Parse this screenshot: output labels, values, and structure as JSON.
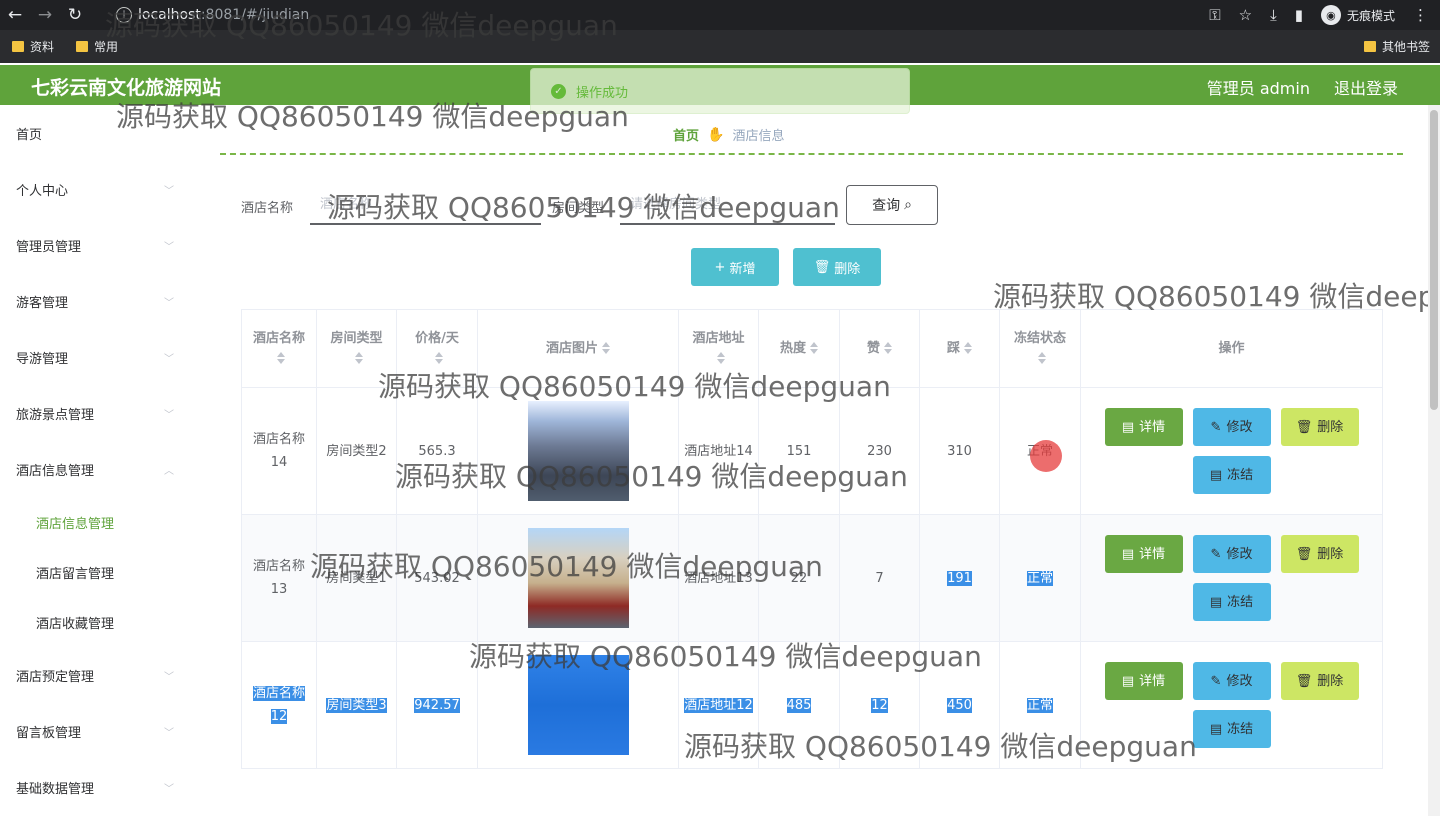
{
  "browser": {
    "url_host": "localhost",
    "url_rest": ":8081/#/jiudian",
    "incognito_label": "无痕模式",
    "bookmarks": [
      "资料",
      "常用"
    ],
    "other_bookmarks": "其他书签"
  },
  "header": {
    "site_title": "七彩云南文化旅游网站",
    "user_label": "管理员 admin",
    "logout_label": "退出登录"
  },
  "toast": {
    "message": "操作成功"
  },
  "sidebar": {
    "items": [
      {
        "label": "首页"
      },
      {
        "label": "个人中心"
      },
      {
        "label": "管理员管理"
      },
      {
        "label": "游客管理"
      },
      {
        "label": "导游管理"
      },
      {
        "label": "旅游景点管理"
      },
      {
        "label": "酒店信息管理"
      },
      {
        "label": "酒店信息管理"
      },
      {
        "label": "酒店留言管理"
      },
      {
        "label": "酒店收藏管理"
      },
      {
        "label": "酒店预定管理"
      },
      {
        "label": "留言板管理"
      },
      {
        "label": "基础数据管理"
      }
    ]
  },
  "breadcrumb": {
    "home": "首页",
    "current": "酒店信息"
  },
  "search": {
    "name_label": "酒店名称",
    "name_placeholder": "酒店名称",
    "type_label": "房间类型",
    "type_placeholder": "请选择房间类型",
    "query_label": "查询"
  },
  "actions": {
    "add_label": "新增",
    "delete_label": "删除"
  },
  "table": {
    "headers": [
      "酒店名称",
      "房间类型",
      "价格/天",
      "酒店图片",
      "酒店地址",
      "热度",
      "赞",
      "踩",
      "冻结状态",
      "操作"
    ],
    "rows": [
      {
        "name": "酒店名称14",
        "type": "房间类型2",
        "price": "565.3",
        "address": "酒店地址14",
        "heat": "151",
        "like": "230",
        "dislike": "310",
        "status": "正常"
      },
      {
        "name": "酒店名称13",
        "type": "房间类型1",
        "price": "543.02",
        "address": "酒店地址13",
        "heat": "22",
        "like": "7",
        "dislike": "191",
        "status": "正常"
      },
      {
        "name": "酒店名称12",
        "type": "房间类型3",
        "price": "942.57",
        "address": "酒店地址12",
        "heat": "485",
        "like": "12",
        "dislike": "450",
        "status": "正常"
      }
    ],
    "op_labels": {
      "detail": "详情",
      "edit": "修改",
      "remove": "删除",
      "freeze": "冻结"
    }
  },
  "watermark": "源码获取 QQ86050149 微信deepguan",
  "colors": {
    "brand_green": "#5fa33b",
    "accent_cyan": "#4fc0d0",
    "selection_blue": "#3b8fe6"
  }
}
